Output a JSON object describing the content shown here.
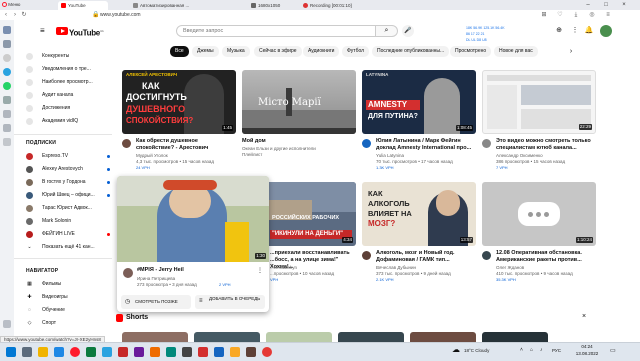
{
  "browser": {
    "menu_label": "Меню",
    "tabs": [
      {
        "label": "YouTube",
        "active": true
      },
      {
        "label": "Автоматизированная ..."
      },
      {
        "label": "1680x1050"
      },
      {
        "label": "Recording [00:01:10]"
      }
    ],
    "url": "www.youtube.com",
    "status_url": "https://www.youtube.com/watch?v=Jr-XE2yHns8"
  },
  "youtube": {
    "logo_text": "YouTube",
    "region": "UA",
    "search_placeholder": "Введите запрос",
    "netstat": {
      "line1": "18K  56.9K  125.1K  56.4K",
      "line2": "86  17  22  21",
      "line3": "DL  UL  D8  U8"
    },
    "guide": {
      "items_top": [
        {
          "label": "Конкуренты"
        },
        {
          "label": "Уведомления о тре..."
        },
        {
          "label": "Наиболее просмотр..."
        },
        {
          "label": "Аудит канала"
        },
        {
          "label": "Достижения"
        },
        {
          "label": "Академия vidIQ"
        }
      ],
      "subs_title": "ПОДПИСКИ",
      "subs": [
        {
          "label": "Espreso.TV"
        },
        {
          "label": "Alexey Arestovych"
        },
        {
          "label": "В гостях у Гордона"
        },
        {
          "label": "Юрий Швец – офици..."
        },
        {
          "label": "Тарас Юрист Адвок..."
        },
        {
          "label": "Mark Solonin"
        },
        {
          "label": "ФЕЙГИН LIVE"
        },
        {
          "label": "Показать ещё 41 кан..."
        }
      ],
      "nav_title": "НАВИГАТОР",
      "nav": [
        {
          "label": "Фильмы"
        },
        {
          "label": "Видеоигры"
        },
        {
          "label": "Обучение"
        },
        {
          "label": "Спорт"
        }
      ]
    },
    "chips": [
      "Все",
      "Джемы",
      "Музыка",
      "Сейчас в эфире",
      "Аудиокниги",
      "Футбол",
      "Последние опубликованны...",
      "Просмотрено",
      "Новое для вас"
    ],
    "videos": [
      {
        "title": "Как обрести душевное спокойствие? - Арестович",
        "channel": "Мудрый Уголок",
        "stats": "4,3 тыс. просмотров • 15 часов назад",
        "extra": "24 VPH",
        "duration": "1:45"
      },
      {
        "title": "Мой дом",
        "channel": "Океан Ельзи и другие исполнители",
        "stats": "",
        "extra": "Плейлист",
        "duration": ""
      },
      {
        "title": "Юлия Латынина / Марк Фейгин доклад Amnesty International про...",
        "channel": "Yulia Latynina",
        "stats": "70 тыс. просмотров • 17 часов назад",
        "extra": "1.3K VPH",
        "duration": "1:08:45"
      },
      {
        "title": "Это видео можно смотреть только специалистам ютюб канала...",
        "channel": "Александр Оксименко",
        "stats": "386 просмотров • 15 часов назад",
        "extra": "7 VPH",
        "duration": "22:29"
      },
      {
        "title": "#MPIЯ - Jerry Heil",
        "channel": "Ирина Петрищева",
        "stats": "273 просмотра • 3 дня назад",
        "extra": "2 VPH",
        "duration": "1:30"
      },
      {
        "title": "...приехали восстанавливать ...босс, а на улице зима!\" Хохма!...",
        "channel": "...veKalashyn",
        "stats": "...просмотров • 10 часов назад",
        "extra": "VPH",
        "duration": "4:34"
      },
      {
        "title": "Алкоголь, мозг и Новый год. Дофаминовая / ГАМК тип...",
        "channel": "Вячеслав Дубынин",
        "stats": "373 тыс. просмотров • 9 дней назад",
        "extra": "2.1K VPH",
        "duration": "13:57"
      },
      {
        "title": "12.08 Оперативная обстановка. Американские ракеты против...",
        "channel": "Олег Жданов",
        "stats": "410 тыс. просмотров • 9 часов назад",
        "extra": "35.3K VPH",
        "duration": "1:10:24"
      }
    ],
    "thumb_text": {
      "t1_name": "АЛЕКСЕЙ АРЕСТОВИЧ",
      "t1_a": "КАК",
      "t1_b": "ДОСТИГНУТЬ",
      "t1_c": "ДУШЕВНОГО",
      "t1_d": "СПОКОЙСТВИЯ?",
      "t2": "Місто Марії",
      "t3_brand": "LATYNINA",
      "t3_a": "AMNESTY",
      "t3_b": "ДЛЯ ПУТИНА?",
      "t6_a": "РОССИЙСКИХ РАБОЧИХ",
      "t6_b": "\"ИКИНУЛИ НА ДЕНЬГИ\"",
      "t7_a": "КАК",
      "t7_b": "АЛКОГОЛЬ",
      "t7_c": "ВЛИЯЕТ НА",
      "t7_d": "МОЗГ?"
    },
    "hover_actions": {
      "watch_later": "СМОТРЕТЬ ПОЗЖЕ",
      "add_queue": "ДОБАВИТЬ В ОЧЕРЕДЬ"
    },
    "shorts_title": "Shorts"
  },
  "taskbar": {
    "weather": "18°C  Cloudy",
    "lang": "РУС",
    "time": "04:24",
    "date": "13.08.2022"
  }
}
